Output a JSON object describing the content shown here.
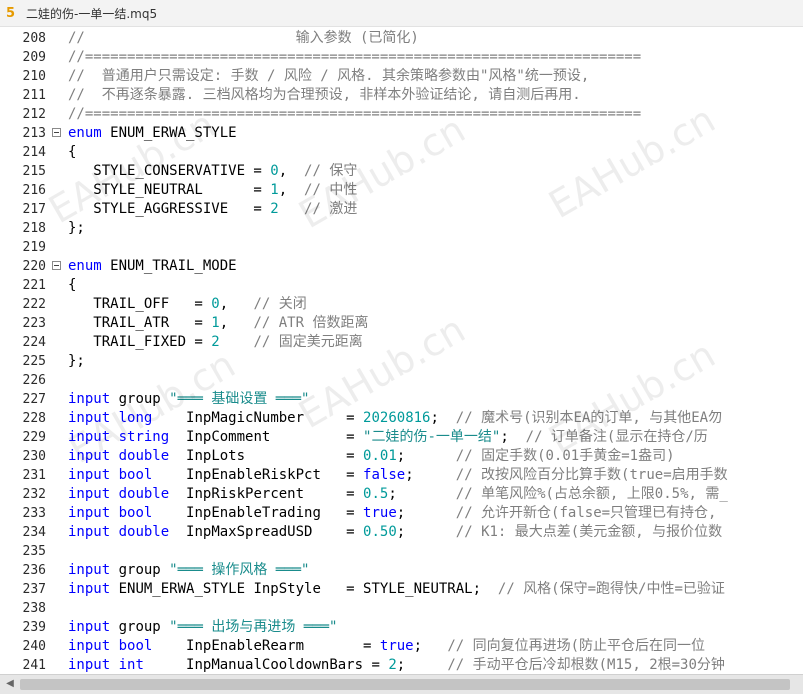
{
  "window": {
    "icon_glyph": "5",
    "title": "二娃的伤-一单一结.mq5"
  },
  "watermark": "EAHub.cn",
  "code_lines": [
    {
      "n": "208",
      "fold": false,
      "tokens": [
        {
          "t": "cmt",
          "v": "//                         输入参数 (已简化)"
        }
      ]
    },
    {
      "n": "209",
      "fold": false,
      "tokens": [
        {
          "t": "cmt",
          "v": "//=================================================================="
        }
      ]
    },
    {
      "n": "210",
      "fold": false,
      "tokens": [
        {
          "t": "cmt",
          "v": "//  普通用户只需设定: 手数 / 风险 / 风格. 其余策略参数由\"风格\"统一预设,"
        }
      ]
    },
    {
      "n": "211",
      "fold": false,
      "tokens": [
        {
          "t": "cmt",
          "v": "//  不再逐条暴露. 三档风格均为合理预设, 非样本外验证结论, 请自测后再用."
        }
      ]
    },
    {
      "n": "212",
      "fold": false,
      "tokens": [
        {
          "t": "cmt",
          "v": "//=================================================================="
        }
      ]
    },
    {
      "n": "213",
      "fold": true,
      "tokens": [
        {
          "t": "kw",
          "v": "enum"
        },
        {
          "t": "plain",
          "v": " ENUM_ERWA_STYLE"
        }
      ]
    },
    {
      "n": "214",
      "fold": false,
      "tokens": [
        {
          "t": "plain",
          "v": "{"
        }
      ]
    },
    {
      "n": "215",
      "fold": false,
      "tokens": [
        {
          "t": "plain",
          "v": "   STYLE_CONSERVATIVE = "
        },
        {
          "t": "num",
          "v": "0"
        },
        {
          "t": "plain",
          "v": ",  "
        },
        {
          "t": "cmt",
          "v": "// 保守"
        }
      ]
    },
    {
      "n": "216",
      "fold": false,
      "tokens": [
        {
          "t": "plain",
          "v": "   STYLE_NEUTRAL      = "
        },
        {
          "t": "num",
          "v": "1"
        },
        {
          "t": "plain",
          "v": ",  "
        },
        {
          "t": "cmt",
          "v": "// 中性"
        }
      ]
    },
    {
      "n": "217",
      "fold": false,
      "tokens": [
        {
          "t": "plain",
          "v": "   STYLE_AGGRESSIVE   = "
        },
        {
          "t": "num",
          "v": "2"
        },
        {
          "t": "plain",
          "v": "   "
        },
        {
          "t": "cmt",
          "v": "// 激进"
        }
      ]
    },
    {
      "n": "218",
      "fold": false,
      "tokens": [
        {
          "t": "plain",
          "v": "};"
        }
      ]
    },
    {
      "n": "219",
      "fold": false,
      "tokens": []
    },
    {
      "n": "220",
      "fold": true,
      "tokens": [
        {
          "t": "kw",
          "v": "enum"
        },
        {
          "t": "plain",
          "v": " ENUM_TRAIL_MODE"
        }
      ]
    },
    {
      "n": "221",
      "fold": false,
      "tokens": [
        {
          "t": "plain",
          "v": "{"
        }
      ]
    },
    {
      "n": "222",
      "fold": false,
      "tokens": [
        {
          "t": "plain",
          "v": "   TRAIL_OFF   = "
        },
        {
          "t": "num",
          "v": "0"
        },
        {
          "t": "plain",
          "v": ",   "
        },
        {
          "t": "cmt",
          "v": "// 关闭"
        }
      ]
    },
    {
      "n": "223",
      "fold": false,
      "tokens": [
        {
          "t": "plain",
          "v": "   TRAIL_ATR   = "
        },
        {
          "t": "num",
          "v": "1"
        },
        {
          "t": "plain",
          "v": ",   "
        },
        {
          "t": "cmt",
          "v": "// ATR 倍数距离"
        }
      ]
    },
    {
      "n": "224",
      "fold": false,
      "tokens": [
        {
          "t": "plain",
          "v": "   TRAIL_FIXED = "
        },
        {
          "t": "num",
          "v": "2"
        },
        {
          "t": "plain",
          "v": "    "
        },
        {
          "t": "cmt",
          "v": "// 固定美元距离"
        }
      ]
    },
    {
      "n": "225",
      "fold": false,
      "tokens": [
        {
          "t": "plain",
          "v": "};"
        }
      ]
    },
    {
      "n": "226",
      "fold": false,
      "tokens": []
    },
    {
      "n": "227",
      "fold": false,
      "tokens": [
        {
          "t": "kw",
          "v": "input"
        },
        {
          "t": "plain",
          "v": " group "
        },
        {
          "t": "str",
          "v": "\"═══ 基础设置 ═══\""
        }
      ]
    },
    {
      "n": "228",
      "fold": false,
      "tokens": [
        {
          "t": "kw",
          "v": "input"
        },
        {
          "t": "plain",
          "v": " "
        },
        {
          "t": "kw",
          "v": "long"
        },
        {
          "t": "plain",
          "v": "    "
        },
        {
          "t": "plain",
          "v": "InpMagicNumber     = "
        },
        {
          "t": "num",
          "v": "20260816"
        },
        {
          "t": "plain",
          "v": ";  "
        },
        {
          "t": "cmt",
          "v": "// 魔术号(识别本EA的订单, 与其他EA勿"
        }
      ]
    },
    {
      "n": "229",
      "fold": false,
      "tokens": [
        {
          "t": "kw",
          "v": "input"
        },
        {
          "t": "plain",
          "v": " "
        },
        {
          "t": "kw",
          "v": "string"
        },
        {
          "t": "plain",
          "v": "  InpComment         = "
        },
        {
          "t": "str",
          "v": "\"二娃的伤-一单一结\""
        },
        {
          "t": "plain",
          "v": ";  "
        },
        {
          "t": "cmt",
          "v": "// 订单备注(显示在持仓/历"
        }
      ]
    },
    {
      "n": "230",
      "fold": false,
      "tokens": [
        {
          "t": "kw",
          "v": "input"
        },
        {
          "t": "plain",
          "v": " "
        },
        {
          "t": "kw",
          "v": "double"
        },
        {
          "t": "plain",
          "v": "  InpLots            = "
        },
        {
          "t": "num",
          "v": "0.01"
        },
        {
          "t": "plain",
          "v": ";      "
        },
        {
          "t": "cmt",
          "v": "// 固定手数(0.01手黄金=1盎司)"
        }
      ]
    },
    {
      "n": "231",
      "fold": false,
      "tokens": [
        {
          "t": "kw",
          "v": "input"
        },
        {
          "t": "plain",
          "v": " "
        },
        {
          "t": "kw",
          "v": "bool"
        },
        {
          "t": "plain",
          "v": "    InpEnableRiskPct   = "
        },
        {
          "t": "kw",
          "v": "false"
        },
        {
          "t": "plain",
          "v": ";     "
        },
        {
          "t": "cmt",
          "v": "// 改按风险百分比算手数(true=启用手数"
        }
      ]
    },
    {
      "n": "232",
      "fold": false,
      "tokens": [
        {
          "t": "kw",
          "v": "input"
        },
        {
          "t": "plain",
          "v": " "
        },
        {
          "t": "kw",
          "v": "double"
        },
        {
          "t": "plain",
          "v": "  InpRiskPercent     = "
        },
        {
          "t": "num",
          "v": "0.5"
        },
        {
          "t": "plain",
          "v": ";       "
        },
        {
          "t": "cmt",
          "v": "// 单笔风险%(占总余额, 上限0.5%, 需_"
        }
      ]
    },
    {
      "n": "233",
      "fold": false,
      "tokens": [
        {
          "t": "kw",
          "v": "input"
        },
        {
          "t": "plain",
          "v": " "
        },
        {
          "t": "kw",
          "v": "bool"
        },
        {
          "t": "plain",
          "v": "    InpEnableTrading   = "
        },
        {
          "t": "kw",
          "v": "true"
        },
        {
          "t": "plain",
          "v": ";      "
        },
        {
          "t": "cmt",
          "v": "// 允许开新仓(false=只管理已有持仓,"
        }
      ]
    },
    {
      "n": "234",
      "fold": false,
      "tokens": [
        {
          "t": "kw",
          "v": "input"
        },
        {
          "t": "plain",
          "v": " "
        },
        {
          "t": "kw",
          "v": "double"
        },
        {
          "t": "plain",
          "v": "  InpMaxSpreadUSD    = "
        },
        {
          "t": "num",
          "v": "0.50"
        },
        {
          "t": "plain",
          "v": ";      "
        },
        {
          "t": "cmt",
          "v": "// K1: 最大点差(美元金额, 与报价位数"
        }
      ]
    },
    {
      "n": "235",
      "fold": false,
      "tokens": []
    },
    {
      "n": "236",
      "fold": false,
      "tokens": [
        {
          "t": "kw",
          "v": "input"
        },
        {
          "t": "plain",
          "v": " group "
        },
        {
          "t": "str",
          "v": "\"═══ 操作风格 ═══\""
        }
      ]
    },
    {
      "n": "237",
      "fold": false,
      "tokens": [
        {
          "t": "kw",
          "v": "input"
        },
        {
          "t": "plain",
          "v": " ENUM_ERWA_STYLE InpStyle   = STYLE_NEUTRAL;  "
        },
        {
          "t": "cmt",
          "v": "// 风格(保守=跑得快/中性=已验证"
        }
      ]
    },
    {
      "n": "238",
      "fold": false,
      "tokens": []
    },
    {
      "n": "239",
      "fold": false,
      "tokens": [
        {
          "t": "kw",
          "v": "input"
        },
        {
          "t": "plain",
          "v": " group "
        },
        {
          "t": "str",
          "v": "\"═══ 出场与再进场 ═══\""
        }
      ]
    },
    {
      "n": "240",
      "fold": false,
      "tokens": [
        {
          "t": "kw",
          "v": "input"
        },
        {
          "t": "plain",
          "v": " "
        },
        {
          "t": "kw",
          "v": "bool"
        },
        {
          "t": "plain",
          "v": "    InpEnableRearm       = "
        },
        {
          "t": "kw",
          "v": "true"
        },
        {
          "t": "plain",
          "v": ";   "
        },
        {
          "t": "cmt",
          "v": "// 同向复位再进场(防止平仓后在同一位"
        }
      ]
    },
    {
      "n": "241",
      "fold": false,
      "tokens": [
        {
          "t": "kw",
          "v": "input"
        },
        {
          "t": "plain",
          "v": " "
        },
        {
          "t": "kw",
          "v": "int"
        },
        {
          "t": "plain",
          "v": "     InpManualCooldownBars = "
        },
        {
          "t": "num",
          "v": "2"
        },
        {
          "t": "plain",
          "v": ";     "
        },
        {
          "t": "cmt",
          "v": "// 手动平仓后冷却根数(M15, 2根=30分钟"
        }
      ]
    }
  ]
}
